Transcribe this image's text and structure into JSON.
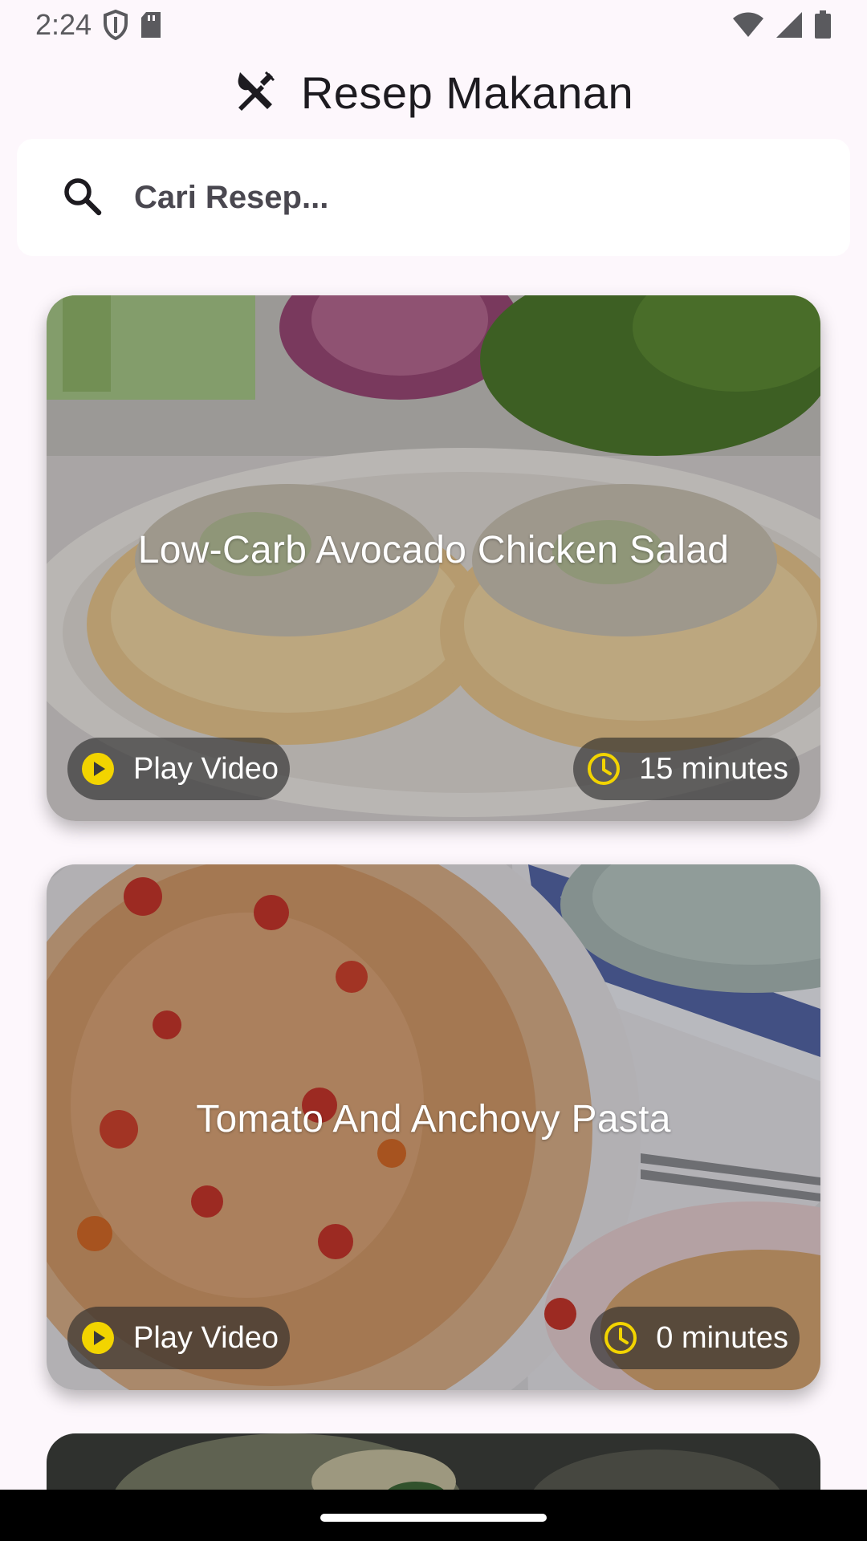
{
  "status_bar": {
    "time": "2:24",
    "icons": [
      "shield-icon",
      "sd-card-icon",
      "wifi-icon",
      "signal-icon",
      "battery-icon"
    ]
  },
  "app_bar": {
    "title": "Resep Makanan",
    "icon": "utensils-icon"
  },
  "search": {
    "placeholder": "Cari Resep...",
    "value": "",
    "icon": "search-icon"
  },
  "recipes": [
    {
      "title": "Low-Carb Avocado Chicken Salad",
      "play_label": "Play Video",
      "duration": "15 minutes"
    },
    {
      "title": "Tomato And Anchovy Pasta",
      "play_label": "Play Video",
      "duration": "0 minutes"
    },
    {
      "title": "",
      "play_label": "",
      "duration": ""
    }
  ],
  "colors": {
    "background": "#fdf7fc",
    "accent_yellow": "#f2d400",
    "pill_bg": "#3a3a3a",
    "nav_bar": "#000000"
  }
}
